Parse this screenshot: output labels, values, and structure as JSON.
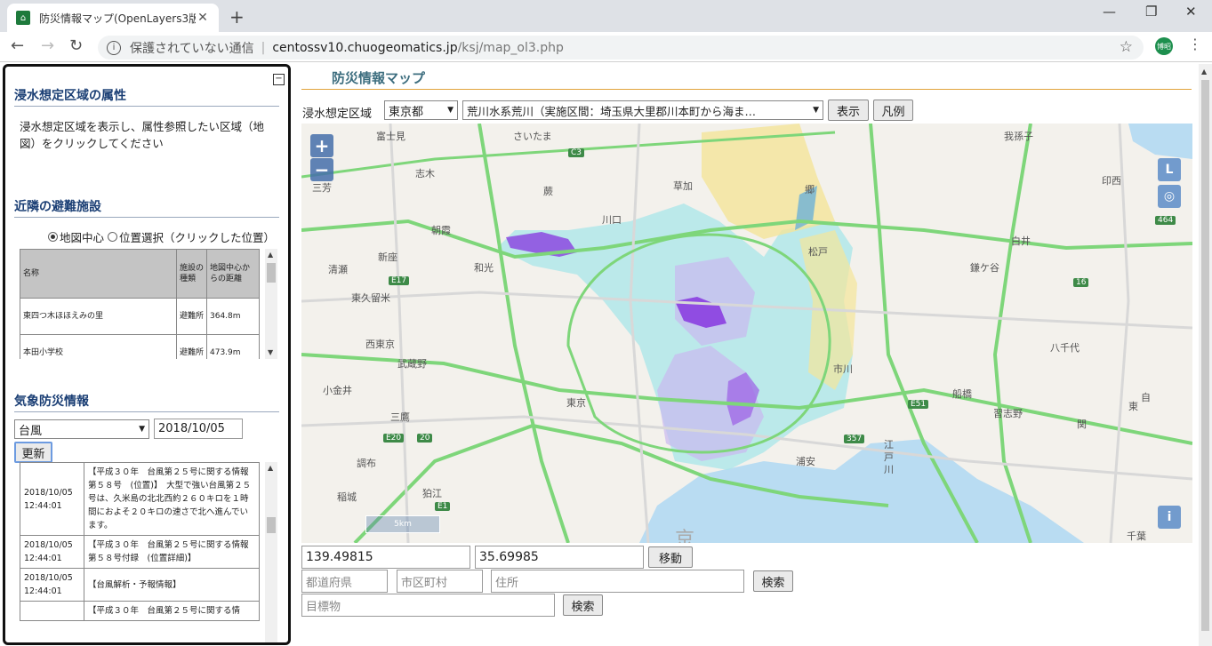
{
  "browser": {
    "tab_title": "防災情報マップ(OpenLayers3版)",
    "new_tab": "+",
    "security_text": "保護されていない通信",
    "url_host": "centossv10.chuogeomatics.jp",
    "url_path": "/ksj/map_ol3.php",
    "profile": "博昭"
  },
  "left_panel": {
    "flood_section": {
      "title": "浸水想定区域の属性",
      "description": "浸水想定区域を表示し、属性参照したい区域（地図）をクリックしてください"
    },
    "shelter_section": {
      "title": "近隣の避難施設",
      "radio_center": "地図中心",
      "radio_select": "位置選択（クリックした位置）",
      "table": {
        "headers": [
          "名称",
          "施設の種類",
          "地図中心からの距離"
        ],
        "rows": [
          [
            "東四つ木ほほえみの里",
            "避難所",
            "364.8m"
          ],
          [
            "本田小学校",
            "避難所",
            "473.9m"
          ]
        ]
      }
    },
    "weather_section": {
      "title": "気象防災情報",
      "type_select": "台風",
      "date_value": "2018/10/05",
      "update_button": "更新",
      "rows": [
        [
          "2018/10/05 12:44:01",
          "【平成３０年　台風第２５号に関する情報　第５８号　(位置)】　大型で強い台風第２５号は、久米島の北北西約２６０キロを１時間におよそ２０キロの速さで北へ進んでいます。"
        ],
        [
          "2018/10/05 12:44:01",
          "【平成３０年　台風第２５号に関する情報　第５８号付録　(位置詳細)】"
        ],
        [
          "2018/10/05 12:44:01",
          "【台風解析・予報情報】"
        ],
        [
          "",
          "【平成３０年　台風第２５号に関する情"
        ]
      ]
    }
  },
  "main": {
    "title": "防災情報マップ",
    "flood_label": "浸水想定区域",
    "pref_select": "東京都",
    "river_select": "荒川水系荒川（実施区間：埼玉県大里郡川本町から海ま…",
    "show_button": "表示",
    "legend_button": "凡例",
    "lon_value": "139.49815",
    "lat_value": "35.69985",
    "move_button": "移動",
    "pref_placeholder": "都道府県",
    "city_placeholder": "市区町村",
    "address_placeholder": "住所",
    "search_button": "検索",
    "landmark_placeholder": "目標物",
    "search_button2": "検索"
  },
  "map": {
    "zoom_in": "+",
    "zoom_out": "−",
    "layer_btn": "L",
    "info_btn": "i",
    "scale": "5km",
    "labels": [
      {
        "text": "富士見"
      },
      {
        "text": "さいたま"
      },
      {
        "text": "我孫子"
      },
      {
        "text": "志木"
      },
      {
        "text": "三芳"
      },
      {
        "text": "蕨"
      },
      {
        "text": "草加"
      },
      {
        "text": "郷"
      },
      {
        "text": "印西"
      },
      {
        "text": "川口"
      },
      {
        "text": "朝霞"
      },
      {
        "text": "新座"
      },
      {
        "text": "和光"
      },
      {
        "text": "清瀬"
      },
      {
        "text": "松戸"
      },
      {
        "text": "白井"
      },
      {
        "text": "鎌ケ谷"
      },
      {
        "text": "東久留米"
      },
      {
        "text": "西東京"
      },
      {
        "text": "武蔵野"
      },
      {
        "text": "市川"
      },
      {
        "text": "八千代"
      },
      {
        "text": "小金井"
      },
      {
        "text": "東京"
      },
      {
        "text": "船橋"
      },
      {
        "text": "自"
      },
      {
        "text": "三鷹"
      },
      {
        "text": "習志野"
      },
      {
        "text": "調布"
      },
      {
        "text": "江戸川"
      },
      {
        "text": "狛江"
      },
      {
        "text": "稲城"
      },
      {
        "text": "浦安"
      },
      {
        "text": "東"
      },
      {
        "text": "関"
      },
      {
        "text": "千葉"
      },
      {
        "text": "京"
      }
    ],
    "shields": [
      "C3",
      "E17",
      "E20",
      "20",
      "E51",
      "357",
      "464",
      "16",
      "E1"
    ]
  },
  "colors": {
    "title_blue": "#1a3e74",
    "accent_orange": "#e2a43c",
    "flood_purple": "#8a3ee0",
    "flood_cyan": "#a8e6ea",
    "flood_yellow": "#f4e59a",
    "road_green": "#7ed67a",
    "sea_blue": "#b9dcf2"
  }
}
